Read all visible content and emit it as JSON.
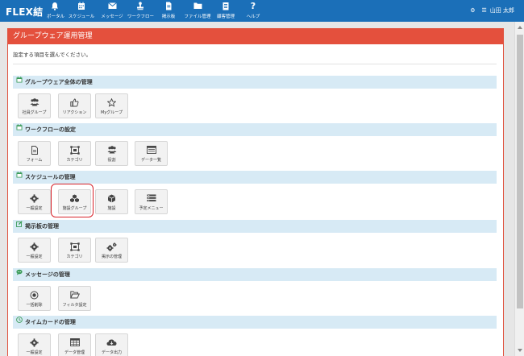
{
  "app": {
    "logo": "FLEX結",
    "title": "グループウェア運用管理"
  },
  "nav": [
    {
      "label": "ポータル",
      "icon": "bell-icon"
    },
    {
      "label": "スケジュール",
      "icon": "calendar-icon"
    },
    {
      "label": "メッセージ",
      "icon": "envelope-icon"
    },
    {
      "label": "ワークフロー",
      "icon": "stamp-icon"
    },
    {
      "label": "掲示板",
      "icon": "document-icon"
    },
    {
      "label": "ファイル管理",
      "icon": "folder-icon"
    },
    {
      "label": "顧客管理",
      "icon": "clipboard-icon"
    },
    {
      "label": "ヘルプ",
      "icon": "question-icon"
    }
  ],
  "user": {
    "name": "山田 太郎"
  },
  "page": {
    "instruction": "設定する項目を選んでください。"
  },
  "sections": [
    {
      "title": "グループウェア全体の管理",
      "icon": "calendar-icon",
      "tiles": [
        {
          "label": "社員グループ",
          "icon": "users-icon"
        },
        {
          "label": "リアクション",
          "icon": "thumbs-up-icon"
        },
        {
          "label": "Myグループ",
          "icon": "star-icon"
        }
      ]
    },
    {
      "title": "ワークフローの設定",
      "icon": "calendar-icon",
      "tiles": [
        {
          "label": "フォーム",
          "icon": "file-icon"
        },
        {
          "label": "カテゴリ",
          "icon": "category-icon"
        },
        {
          "label": "役割",
          "icon": "users-icon"
        },
        {
          "label": "データ一覧",
          "icon": "list-icon"
        }
      ]
    },
    {
      "title": "スケジュールの管理",
      "icon": "calendar-icon",
      "tiles": [
        {
          "label": "一般設定",
          "icon": "gear-icon"
        },
        {
          "label": "施設グループ",
          "icon": "cubes-icon"
        },
        {
          "label": "施設",
          "icon": "cube-icon"
        },
        {
          "label": "予定メニュー",
          "icon": "menu-icon"
        }
      ]
    },
    {
      "title": "掲示板の管理",
      "icon": "edit-icon",
      "tiles": [
        {
          "label": "一般設定",
          "icon": "gear-icon"
        },
        {
          "label": "カテゴリ",
          "icon": "category-icon"
        },
        {
          "label": "掲示の管理",
          "icon": "gears-icon"
        }
      ]
    },
    {
      "title": "メッセージの管理",
      "icon": "chat-icon",
      "tiles": [
        {
          "label": "一括削除",
          "icon": "circle-dot-icon"
        },
        {
          "label": "フィルタ設定",
          "icon": "folder-open-icon"
        }
      ]
    },
    {
      "title": "タイムカードの管理",
      "icon": "clock-icon",
      "tiles": [
        {
          "label": "一般設定",
          "icon": "gear-icon"
        },
        {
          "label": "データ管理",
          "icon": "table-icon"
        },
        {
          "label": "データ出力",
          "icon": "cloud-download-icon"
        }
      ]
    }
  ],
  "colors": {
    "topbar": "#1b6fb8",
    "panel_header": "#e4503d",
    "section_bar": "#d7eaf5",
    "highlight": "#d8232a"
  }
}
